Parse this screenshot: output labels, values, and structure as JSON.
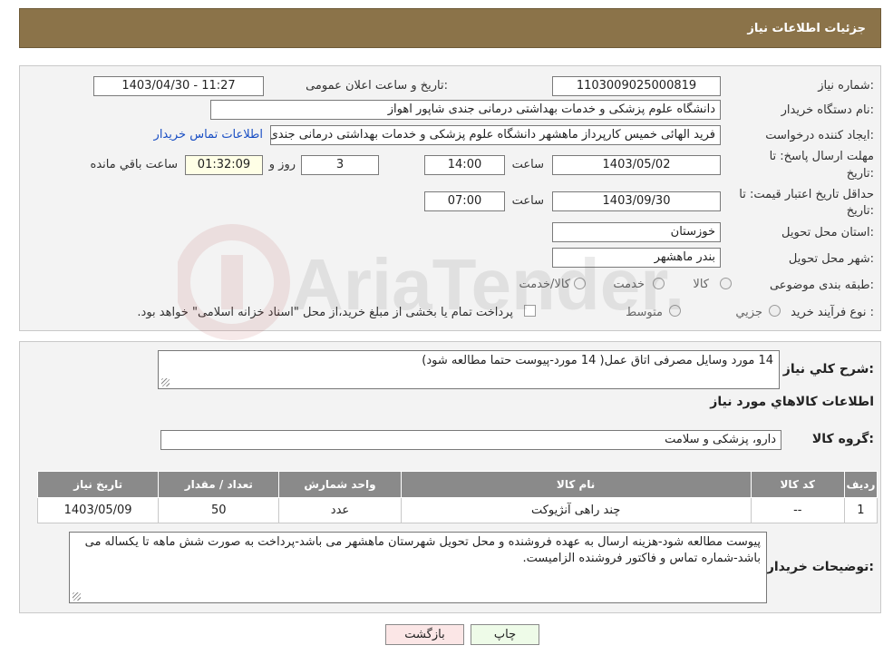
{
  "header": {
    "title": "جزئیات اطلاعات نیاز"
  },
  "fields": {
    "need_number_label": "شماره نیاز:",
    "need_number": "1103009025000819",
    "announce_label": "تاریخ و ساعت اعلان عمومی:",
    "announce_value": "1403/04/30 - 11:27",
    "buyer_org_label": "نام دستگاه خریدار:",
    "buyer_org": "دانشگاه علوم پزشکی و خدمات بهداشتی درمانی جندی شاپور اهواز",
    "creator_label": "ایجاد کننده درخواست:",
    "creator": "فرید الهائی خمیس کارپرداز ماهشهر دانشگاه علوم پزشکی و خدمات بهداشتی درمانی جندی شاپور اهواز",
    "contact_link": "اطلاعات تماس خریدار",
    "deadline_label_1": "مهلت ارسال پاسخ: تا",
    "deadline_label_2": "تاریخ:",
    "deadline_date": "1403/05/02",
    "time_label": "ساعت",
    "deadline_time": "14:00",
    "days_value": "3",
    "days_label": "روز و",
    "remaining_time": "01:32:09",
    "remaining_label": "ساعت باقي مانده",
    "validity_label_1": "حداقل تاریخ اعتبار قیمت: تا",
    "validity_label_2": "تاریخ:",
    "validity_date": "1403/09/30",
    "validity_time_label": "ساعت",
    "validity_time": "07:00",
    "province_label": "استان محل تحویل:",
    "province": "خوزستان",
    "city_label": "شهر محل تحویل:",
    "city": "بندر ماهشهر",
    "category_label": "طبقه بندی موضوعی:",
    "category_options": [
      "کالا",
      "خدمت",
      "کالا/خدمت"
    ],
    "process_label": "نوع فرآیند خرید :",
    "process_options": [
      "جزیي",
      "متوسط"
    ],
    "payment_note": "پرداخت تمام یا بخشی از مبلغ خرید،از محل \"اسناد خزانه اسلامی\" خواهد بود."
  },
  "details": {
    "summary_label": "شرح کلي نیاز:",
    "summary": "14 مورد وسایل مصرفی اتاق عمل( 14 مورد-پیوست حتما مطالعه شود)",
    "goods_title": "اطلاعات کالاهاي مورد نیاز",
    "group_label": "گروه کالا:",
    "group": "دارو، پزشکی و سلامت",
    "table_headers": [
      "ردیف",
      "کد کالا",
      "نام کالا",
      "واحد شمارش",
      "تعداد / مقدار",
      "تاریخ نیاز"
    ],
    "rows": [
      {
        "index": "1",
        "code": "--",
        "name": "چند راهی آنژیوکت",
        "unit": "عدد",
        "qty": "50",
        "date": "1403/05/09"
      }
    ],
    "buyer_notes_label": "توضیحات خریدار:",
    "buyer_notes": "پیوست مطالعه شود-هزینه ارسال به عهده فروشنده و محل تحویل شهرستان ماهشهر می باشد-پرداخت  به صورت شش ماهه تا یکساله می باشد-شماره تماس و فاکتور فروشنده الزامیست."
  },
  "buttons": {
    "print": "چاپ",
    "back": "بازگشت"
  },
  "watermark": {
    "text": "AriaTender.neT"
  }
}
